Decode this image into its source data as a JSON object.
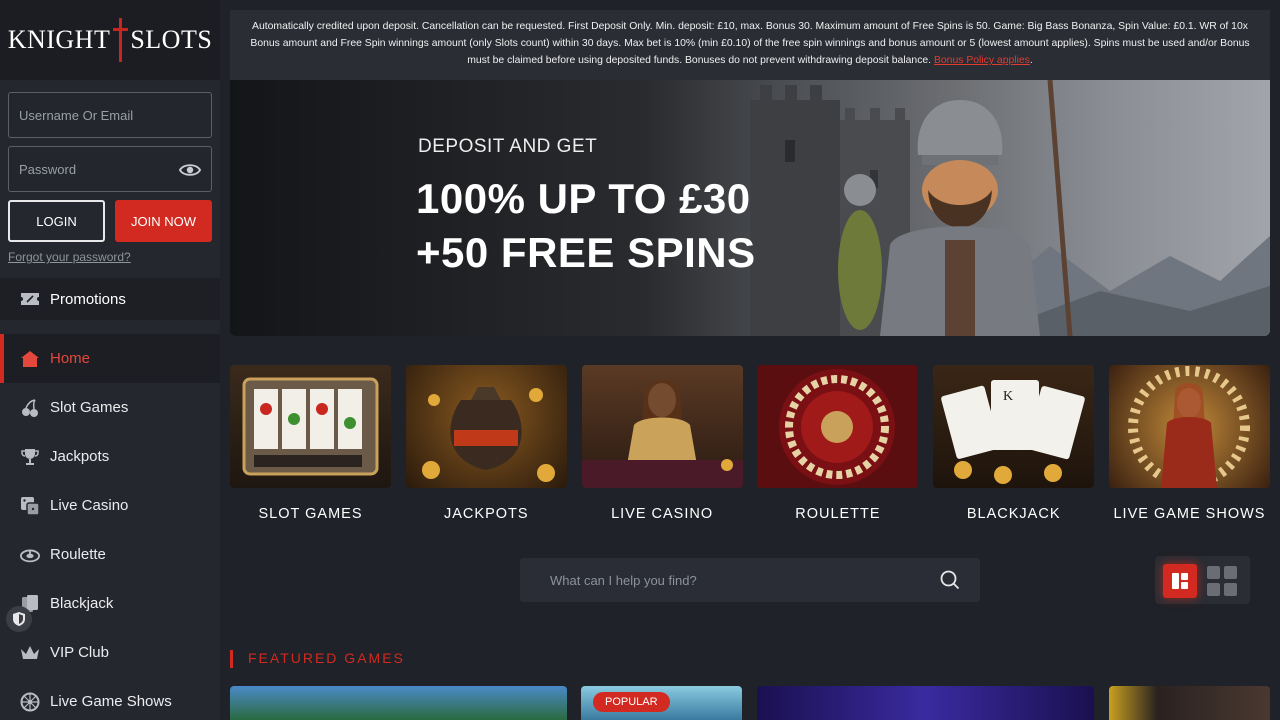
{
  "brand": {
    "logo_left": "KNIGHT",
    "logo_right": "SLOTS"
  },
  "login": {
    "username_placeholder": "Username Or Email",
    "password_placeholder": "Password",
    "login_label": "LOGIN",
    "join_label": "JOIN NOW",
    "forgot_label": "Forgot your password?"
  },
  "promotions": {
    "label": "Promotions",
    "icon": "ticket-icon"
  },
  "nav": [
    {
      "label": "Home",
      "icon": "home-icon",
      "active": true
    },
    {
      "label": "Slot Games",
      "icon": "cherries-icon"
    },
    {
      "label": "Jackpots",
      "icon": "trophy-icon"
    },
    {
      "label": "Live Casino",
      "icon": "dice-icon"
    },
    {
      "label": "Roulette",
      "icon": "roulette-icon"
    },
    {
      "label": "Blackjack",
      "icon": "cards-icon"
    },
    {
      "label": "VIP Club",
      "icon": "crown-icon"
    },
    {
      "label": "Live Game Shows",
      "icon": "wheel-icon"
    }
  ],
  "notice": {
    "text": "Automatically credited upon deposit. Cancellation can be requested. First Deposit Only. Min. deposit: £10, max. Bonus 30. Maximum amount of Free Spins is 50. Game: Big Bass Bonanza, Spin Value: £0.1. WR of 10x Bonus amount and Free Spin winnings amount (only Slots count) within 30 days. Max bet is 10% (min £0.10) of the free spin winnings and bonus amount or 5 (lowest amount applies). Spins must be used and/or Bonus must be claimed before using deposited funds. Bonuses do not prevent withdrawing deposit balance.",
    "link": "Bonus Policy applies",
    "end": "."
  },
  "banner": {
    "sub": "DEPOSIT AND GET",
    "line1": "100% UP TO £30",
    "line2": "+50 FREE SPINS"
  },
  "categories": [
    {
      "label": "SLOT GAMES"
    },
    {
      "label": "JACKPOTS"
    },
    {
      "label": "LIVE CASINO"
    },
    {
      "label": "ROULETTE"
    },
    {
      "label": "BLACKJACK"
    },
    {
      "label": "LIVE GAME SHOWS"
    }
  ],
  "search": {
    "placeholder": "What can I help you find?"
  },
  "featured": {
    "title": "FEATURED GAMES",
    "popular_badge": "POPULAR"
  },
  "colors": {
    "accent": "#d22a20",
    "sidebar": "#24272e",
    "background": "#1f2228"
  }
}
